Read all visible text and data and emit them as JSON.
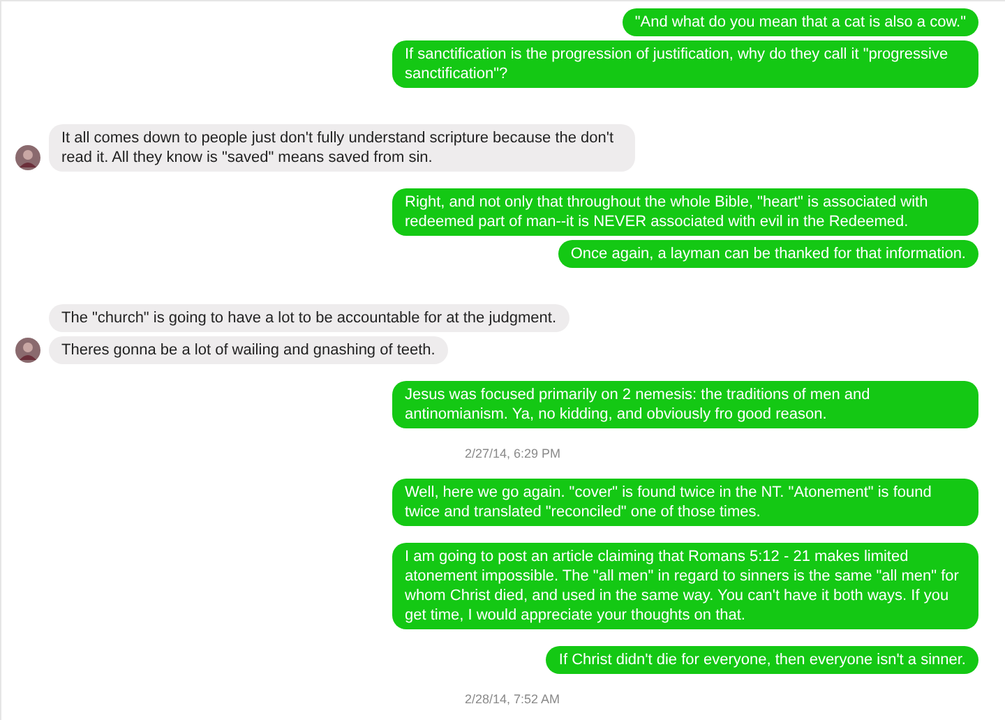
{
  "groups": [
    {
      "kind": "sent",
      "messages": [
        "\"And what do you mean that a cat is also a cow.\"",
        "If sanctification is the progression of justification,  why do they call it \"progressive sanctification\"?"
      ]
    },
    {
      "kind": "received",
      "messages": [
        "It all comes down to people just don't fully understand scripture because the don't read it. All they know is \"saved\" means saved from sin."
      ]
    },
    {
      "kind": "sent",
      "messages": [
        "Right, and not only that throughout the whole Bible, \"heart\" is associated with redeemed part of man--it is NEVER associated with evil in the Redeemed.",
        "Once again, a layman can be thanked for that information."
      ]
    },
    {
      "kind": "received",
      "messages": [
        "The \"church\" is going to have a lot to be accountable for at the judgment.",
        "Theres gonna be a lot of wailing and gnashing of teeth."
      ]
    },
    {
      "kind": "sent",
      "messages": [
        "Jesus was focused primarily on 2 nemesis: the traditions of men and antinomianism. Ya, no kidding, and obviously fro good reason."
      ]
    },
    {
      "kind": "timestamp",
      "text": "2/27/14, 6:29 PM"
    },
    {
      "kind": "sent",
      "messages": [
        "Well, here we go again. \"cover\" is found twice in the NT. \"Atonement\" is found twice and translated \"reconciled\"  one of those times."
      ]
    },
    {
      "kind": "sent",
      "messages": [
        "I am going to post an article claiming that Romans 5:12 - 21 makes limited atonement impossible. The \"all men\" in regard to sinners is the same \"all men\" for whom Christ died, and used in the same way. You can't have it both ways. If you get time, I would appreciate your thoughts on that."
      ]
    },
    {
      "kind": "sent",
      "messages": [
        "If Christ didn't die for everyone, then everyone isn't a sinner."
      ]
    },
    {
      "kind": "timestamp",
      "text": "2/28/14, 7:52 AM"
    }
  ]
}
